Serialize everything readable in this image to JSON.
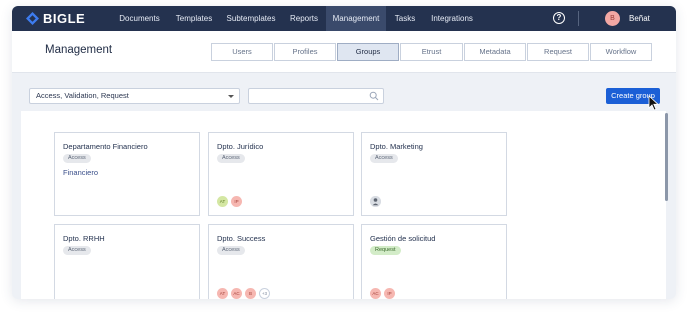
{
  "nav": {
    "logo": "BIGLE",
    "items": [
      {
        "label": "Documents",
        "active": false
      },
      {
        "label": "Templates",
        "active": false
      },
      {
        "label": "Subtemplates",
        "active": false
      },
      {
        "label": "Reports",
        "active": false
      },
      {
        "label": "Management",
        "active": true
      },
      {
        "label": "Tasks",
        "active": false
      },
      {
        "label": "Integrations",
        "active": false
      }
    ],
    "help": "?",
    "user": {
      "initial": "B",
      "name": "Beñat"
    }
  },
  "header": {
    "title": "Management",
    "tabs": [
      {
        "label": "Users",
        "active": false
      },
      {
        "label": "Profiles",
        "active": false
      },
      {
        "label": "Groups",
        "active": true
      },
      {
        "label": "Etrust",
        "active": false
      },
      {
        "label": "Metadata",
        "active": false
      },
      {
        "label": "Request",
        "active": false
      },
      {
        "label": "Workflow",
        "active": false
      }
    ]
  },
  "filters": {
    "select_value": "Access, Validation, Request",
    "search_value": "",
    "search_placeholder": ""
  },
  "create_button": "Create group",
  "groups": [
    {
      "title": "Departamento Financiero",
      "badge": "Access",
      "subgroup": "Financiero",
      "members": []
    },
    {
      "title": "Dpto. Jurídico",
      "badge": "Access",
      "subgroup": "",
      "members": [
        {
          "initials": "AT",
          "color": "green"
        },
        {
          "initials": "IP",
          "color": "red"
        }
      ]
    },
    {
      "title": "Dpto. Marketing",
      "badge": "Access",
      "subgroup": "",
      "members": [
        {
          "initials": "",
          "color": "photo"
        }
      ]
    },
    {
      "title": "Dpto. RRHH",
      "badge": "Access",
      "subgroup": "",
      "members": []
    },
    {
      "title": "Dpto. Success",
      "badge": "Access",
      "subgroup": "",
      "members": [
        {
          "initials": "AT",
          "color": "red"
        },
        {
          "initials": "AC",
          "color": "red"
        },
        {
          "initials": "B",
          "color": "red"
        },
        {
          "initials": "+3",
          "color": "more"
        }
      ]
    },
    {
      "title": "Gestión de solicitud",
      "badge": "Request",
      "subgroup": "",
      "members": [
        {
          "initials": "AC",
          "color": "red"
        },
        {
          "initials": "IP",
          "color": "red"
        }
      ]
    }
  ],
  "colors": {
    "nav_bg": "#24324f",
    "nav_active": "#3a4a6b",
    "primary_button": "#1b5fd6",
    "page_bg": "#eef1f6"
  }
}
